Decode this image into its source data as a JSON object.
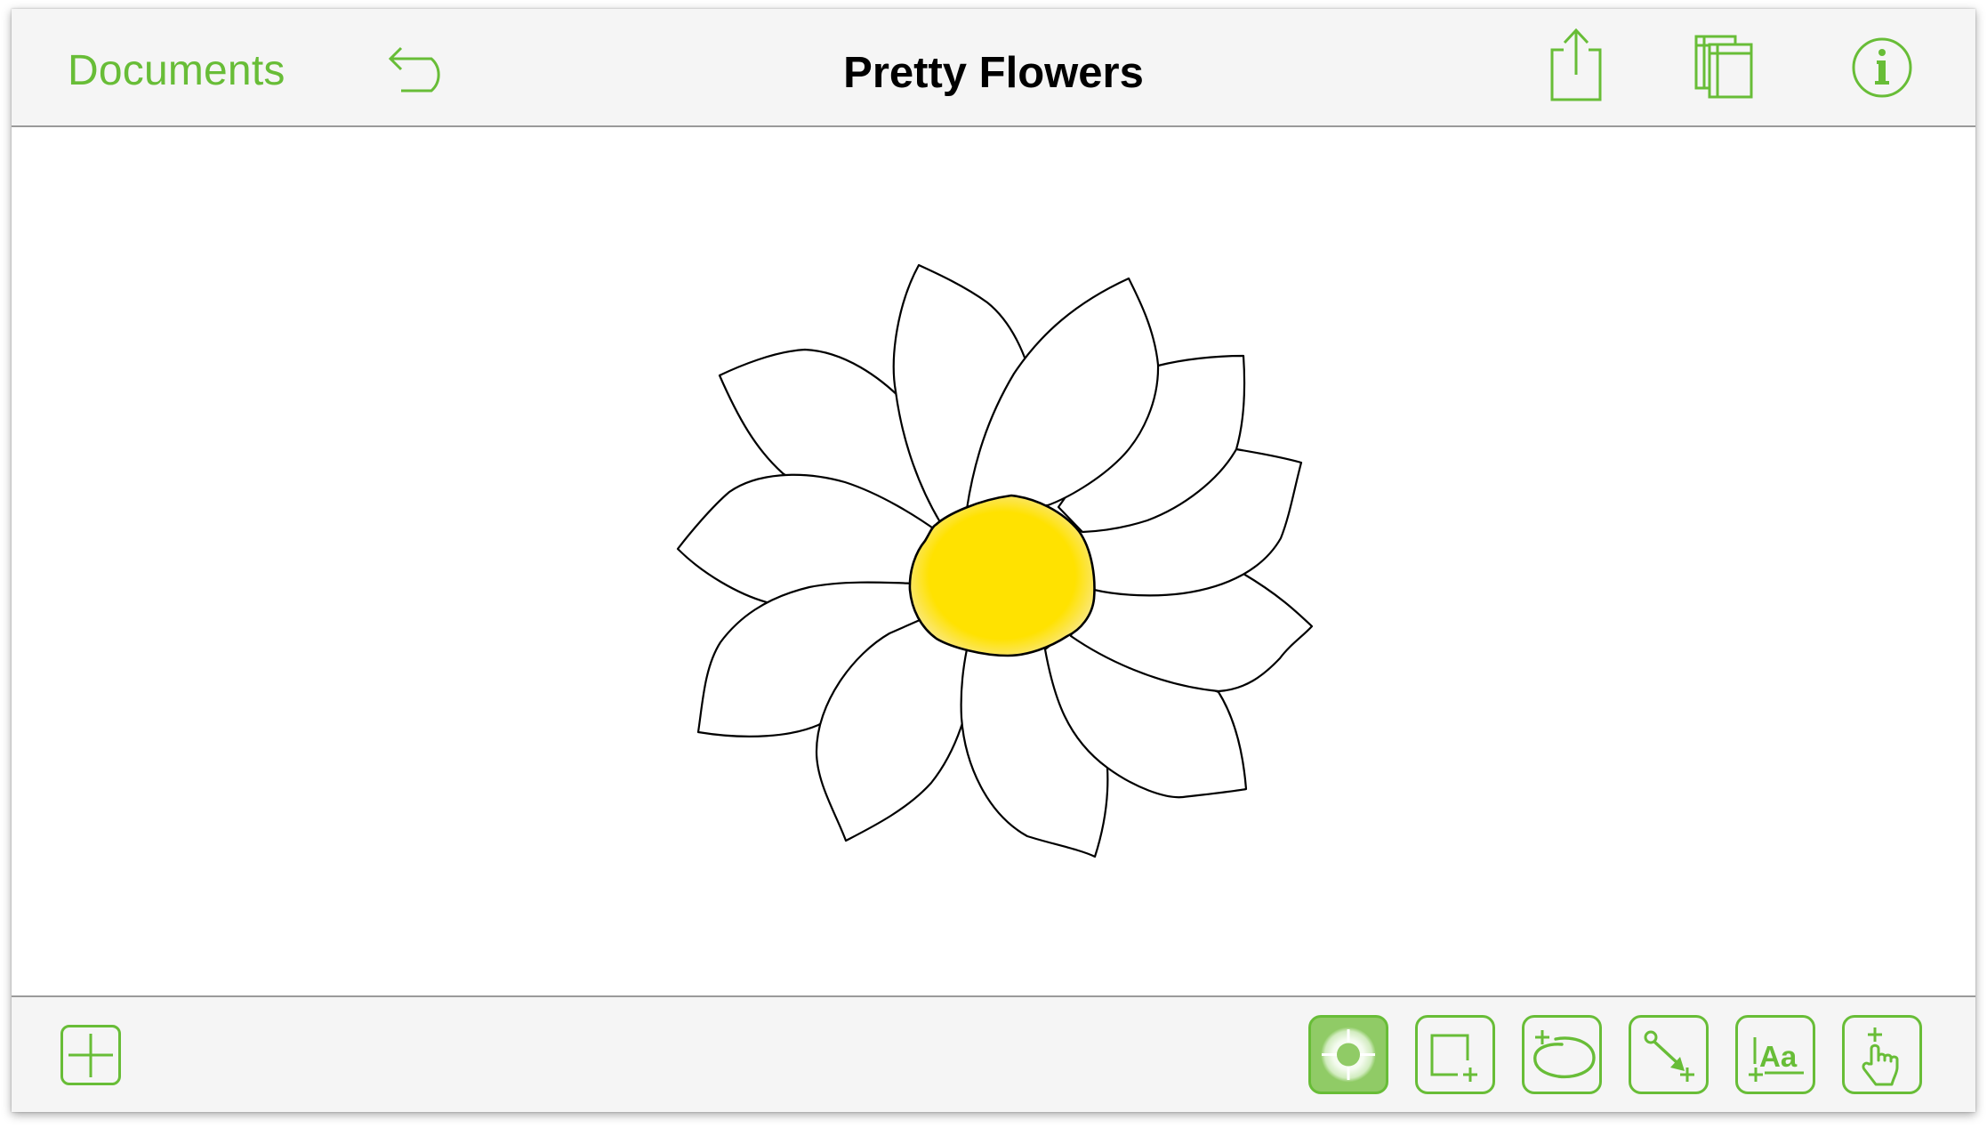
{
  "theme": {
    "accent": "#68BD37",
    "accent_light": "#90CB66",
    "title_color": "#000000",
    "flower_center_color": "#FFE200",
    "petal_fill": "#FFFFFF",
    "petal_stroke": "#000000"
  },
  "header": {
    "documents_label": "Documents",
    "title": "Pretty Flowers",
    "left_icons": [
      {
        "name": "undo-icon"
      }
    ],
    "right_icons": [
      {
        "name": "share-icon"
      },
      {
        "name": "canvases-icon"
      },
      {
        "name": "info-icon"
      }
    ]
  },
  "canvas": {
    "drawing": "flower",
    "petal_count": 11
  },
  "toolbar": {
    "add_button": {
      "icon": "plus-icon"
    },
    "tools": [
      {
        "id": "selection",
        "icon": "selection-tool-icon",
        "active": true
      },
      {
        "id": "shape",
        "icon": "shape-tool-icon",
        "active": false
      },
      {
        "id": "freehand",
        "icon": "freehand-tool-icon",
        "active": false
      },
      {
        "id": "line",
        "icon": "line-tool-icon",
        "active": false
      },
      {
        "id": "text",
        "icon": "text-tool-icon",
        "active": false,
        "glyph": "Aa"
      },
      {
        "id": "point",
        "icon": "point-tool-icon",
        "active": false
      }
    ]
  }
}
